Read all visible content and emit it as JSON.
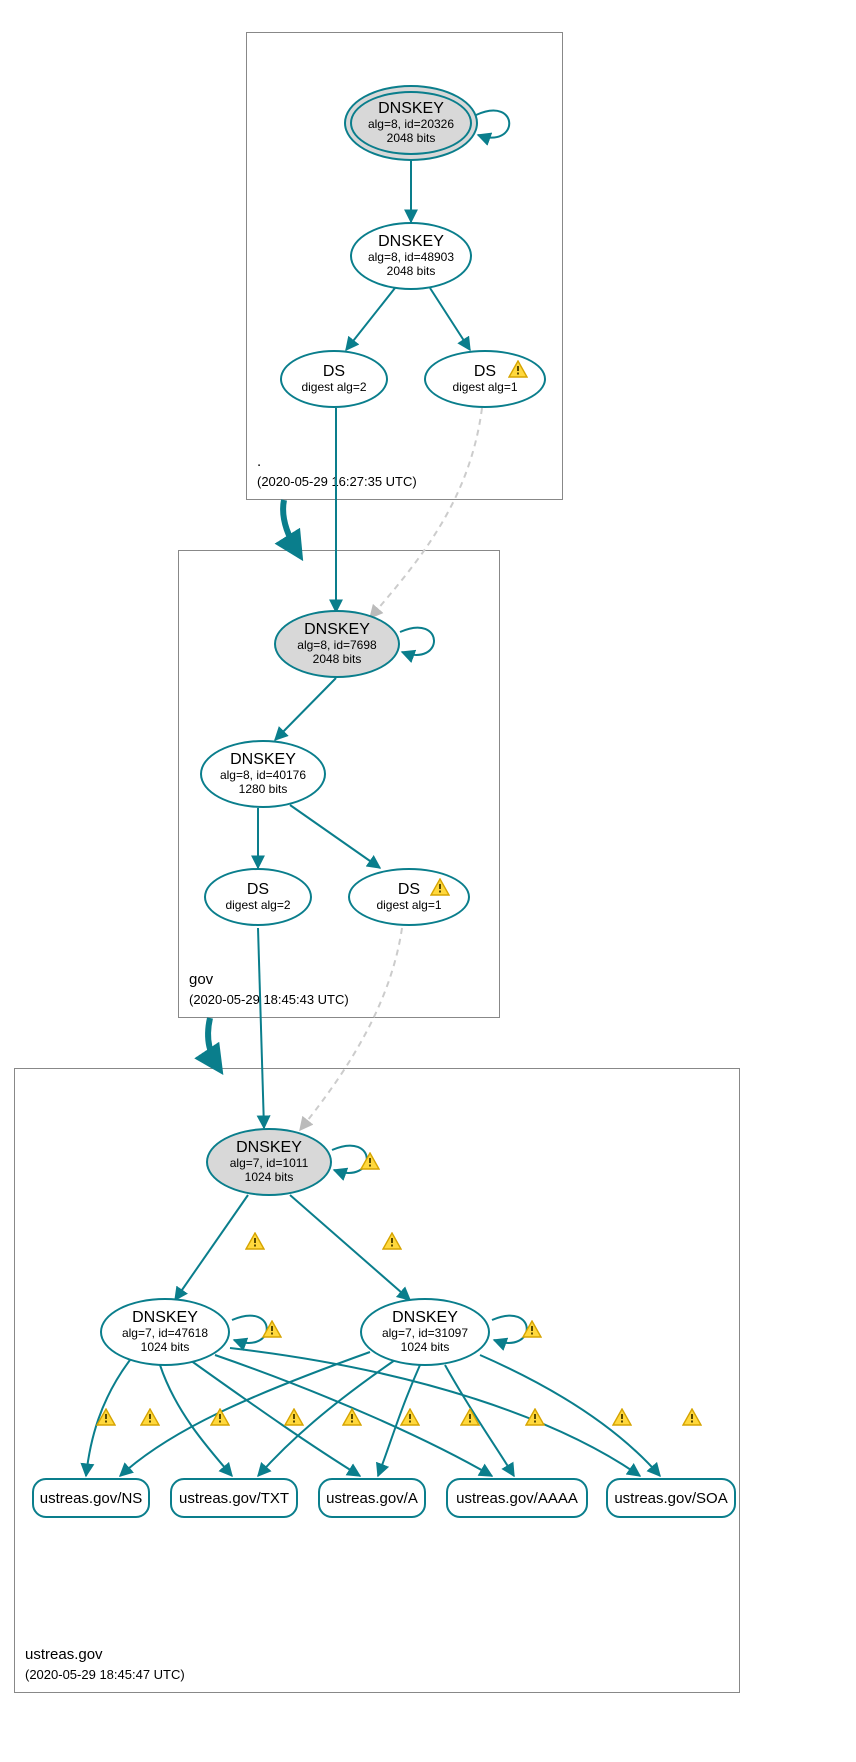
{
  "zones": {
    "root": {
      "name": ".",
      "timestamp": "(2020-05-29 16:27:35 UTC)"
    },
    "gov": {
      "name": "gov",
      "timestamp": "(2020-05-29 18:45:43 UTC)"
    },
    "ustreas": {
      "name": "ustreas.gov",
      "timestamp": "(2020-05-29 18:45:47 UTC)"
    }
  },
  "nodes": {
    "root_ksk": {
      "title": "DNSKEY",
      "line1": "alg=8, id=20326",
      "line2": "2048 bits"
    },
    "root_zsk": {
      "title": "DNSKEY",
      "line1": "alg=8, id=48903",
      "line2": "2048 bits"
    },
    "root_ds2": {
      "title": "DS",
      "line1": "digest alg=2",
      "line2": ""
    },
    "root_ds1": {
      "title": "DS",
      "line1": "digest alg=1",
      "line2": ""
    },
    "gov_ksk": {
      "title": "DNSKEY",
      "line1": "alg=8, id=7698",
      "line2": "2048 bits"
    },
    "gov_zsk": {
      "title": "DNSKEY",
      "line1": "alg=8, id=40176",
      "line2": "1280 bits"
    },
    "gov_ds2": {
      "title": "DS",
      "line1": "digest alg=2",
      "line2": ""
    },
    "gov_ds1": {
      "title": "DS",
      "line1": "digest alg=1",
      "line2": ""
    },
    "ut_ksk": {
      "title": "DNSKEY",
      "line1": "alg=7, id=1011",
      "line2": "1024 bits"
    },
    "ut_zsk1": {
      "title": "DNSKEY",
      "line1": "alg=7, id=47618",
      "line2": "1024 bits"
    },
    "ut_zsk2": {
      "title": "DNSKEY",
      "line1": "alg=7, id=31097",
      "line2": "1024 bits"
    }
  },
  "rr": {
    "ns": "ustreas.gov/NS",
    "txt": "ustreas.gov/TXT",
    "a": "ustreas.gov/A",
    "aaaa": "ustreas.gov/AAAA",
    "soa": "ustreas.gov/SOA"
  }
}
